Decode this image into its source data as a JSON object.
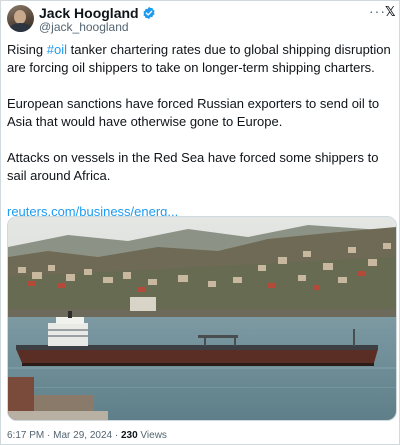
{
  "author": {
    "display_name": "Jack Hoogland",
    "handle": "@jack_hoogland",
    "verified": true
  },
  "tweet": {
    "p1_before": "Rising ",
    "p1_hashtag": "#oil",
    "p1_after": " tanker chartering rates due to global shipping disruption are forcing oil shippers to take on longer-term shipping charters.",
    "p2": "European sanctions have forced Russian exporters to send oil to Asia that would have otherwise gone to Europe.",
    "p3": "Attacks on vessels in the Red Sea have forced some shippers to sail around Africa.",
    "link": "reuters.com/business/energ..."
  },
  "meta": {
    "time": "6:17 PM",
    "separator": " · ",
    "date": "Mar 29, 2024",
    "views_count": "230",
    "views_label": " Views"
  },
  "icons": {
    "more": "more-options-icon",
    "platform": "x-logo-icon",
    "verified": "verified-badge-icon"
  },
  "colors": {
    "accent": "#1d9bf0",
    "text": "#0f1419",
    "secondary": "#536471",
    "border": "#cfd9de"
  }
}
